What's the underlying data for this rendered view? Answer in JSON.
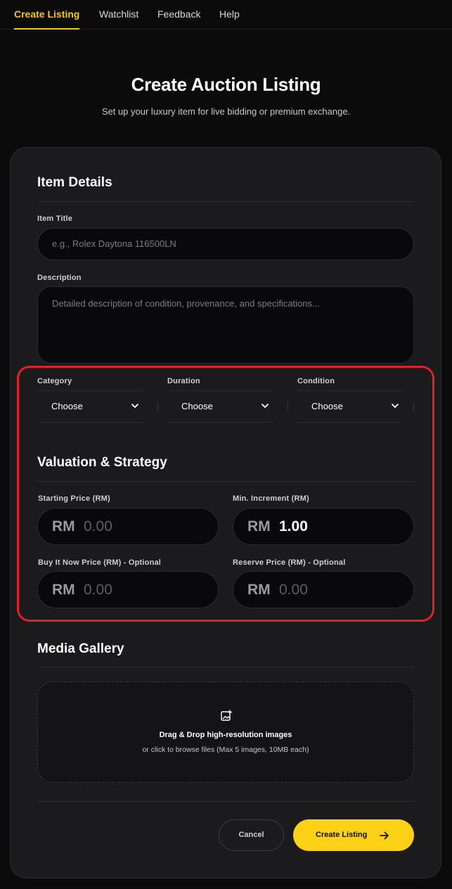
{
  "nav": {
    "items": [
      {
        "label": "Create Listing",
        "active": true
      },
      {
        "label": "Watchlist",
        "active": false
      },
      {
        "label": "Feedback",
        "active": false
      },
      {
        "label": "Help",
        "active": false
      }
    ]
  },
  "header": {
    "title": "Create Auction Listing",
    "subtitle": "Set up your luxury item for live bidding or premium exchange."
  },
  "item_details": {
    "title": "Item Details",
    "item_title": {
      "label": "Item Title",
      "placeholder": "e.g., Rolex Daytona 116500LN"
    },
    "description": {
      "label": "Description",
      "placeholder": "Detailed description of condition, provenance, and specifications..."
    },
    "category": {
      "label": "Category",
      "value": "Choose"
    },
    "duration": {
      "label": "Duration",
      "value": "Choose"
    },
    "condition": {
      "label": "Condition",
      "value": "Choose"
    }
  },
  "valuation": {
    "title": "Valuation & Strategy",
    "currency": "RM",
    "starting_price": {
      "label": "Starting Price (RM)",
      "placeholder": "0.00"
    },
    "min_increment": {
      "label": "Min. Increment (RM)",
      "value": "1.00"
    },
    "buy_it_now": {
      "label": "Buy It Now Price (RM) - Optional",
      "placeholder": "0.00"
    },
    "reserve_price": {
      "label": "Reserve Price (RM) - Optional",
      "placeholder": "0.00"
    }
  },
  "media": {
    "title": "Media Gallery",
    "drop_title": "Drag & Drop high-resolution images",
    "drop_subtitle": "or click to browse files (Max 5 images, 10MB each)"
  },
  "actions": {
    "cancel_label": "Cancel",
    "create_label": "Create Listing"
  },
  "colors": {
    "accent": "#fcd116",
    "highlight": "#e0202a",
    "background": "#0b0b0c",
    "card": "#1b1b1e"
  }
}
